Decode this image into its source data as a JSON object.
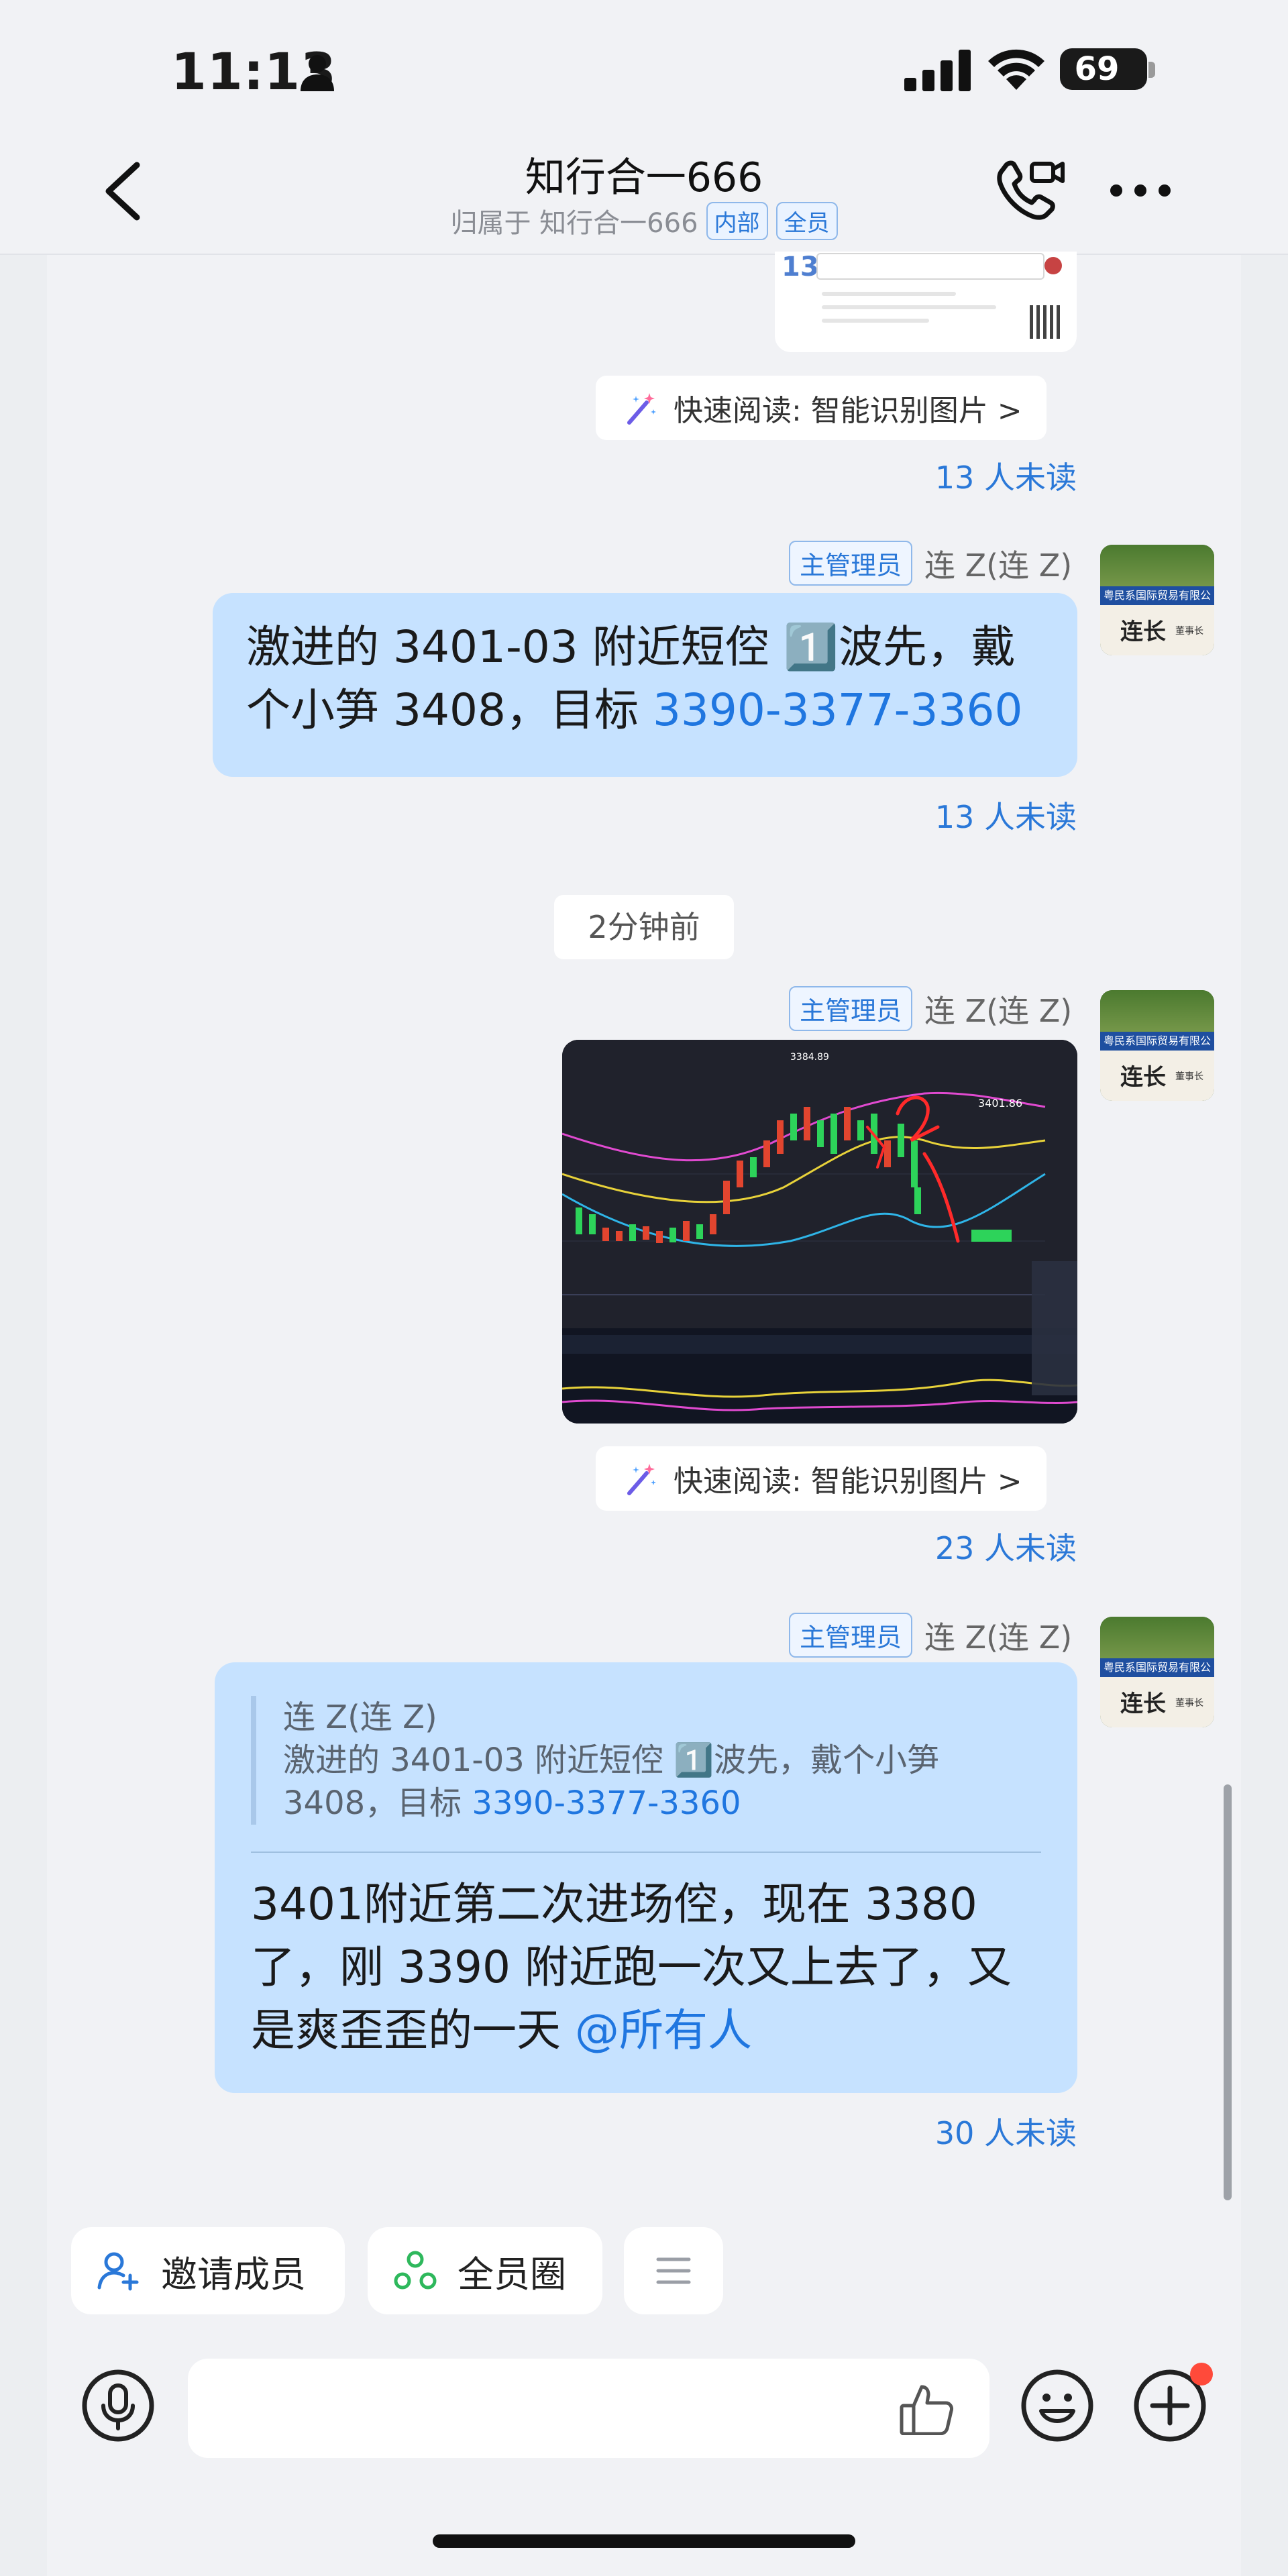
{
  "status_bar": {
    "time": "11:13",
    "battery": "69"
  },
  "header": {
    "title": "知行合一666",
    "subtitle_prefix": "归属于 知行合一666",
    "tag_internal": "内部",
    "tag_all": "全员"
  },
  "messages": {
    "quick_read_label": "快速阅读: 智能识别图片 >",
    "msg1_unread": "13 人未读",
    "msg2": {
      "role": "主管理员",
      "sender": "连 Z(连 Z)",
      "text_plain": "激进的 3401-03 附近短倥 1️⃣波先，戴个小笋 3408，目标 ",
      "text_link": "3390-3377-3360",
      "unread": "13 人未读"
    },
    "time_divider": "2分钟前",
    "msg3": {
      "role": "主管理员",
      "sender": "连 Z(连 Z)",
      "unread": "23 人未读"
    },
    "msg4": {
      "role": "主管理员",
      "sender": "连 Z(连 Z)",
      "quote_sender": "连 Z(连 Z)",
      "quote_text_plain": "激进的 3401-03 附近短倥 1️⃣波先，戴个小笋 3408，目标 ",
      "quote_text_link": "3390-3377-3360",
      "text_plain": "3401附近第二次进场倥，现在 3380 了，刚 3390 附近跑一次又上去了，又是爽歪歪的一天 ",
      "text_link": "@所有人",
      "unread": "30 人未读"
    }
  },
  "avatar": {
    "sign_text": "粤民系国际贸易有限公司",
    "name": "连长",
    "subtitle": "董事长"
  },
  "chart_preview": {
    "price_high": "3401.86",
    "label_top": "3384.89"
  },
  "quick_actions": {
    "invite": "邀请成员",
    "circle": "全员圈"
  },
  "input": {
    "placeholder": ""
  },
  "colors": {
    "accent": "#2a78d8",
    "bubble": "#c6e2ff",
    "background": "#f1f2f5"
  }
}
